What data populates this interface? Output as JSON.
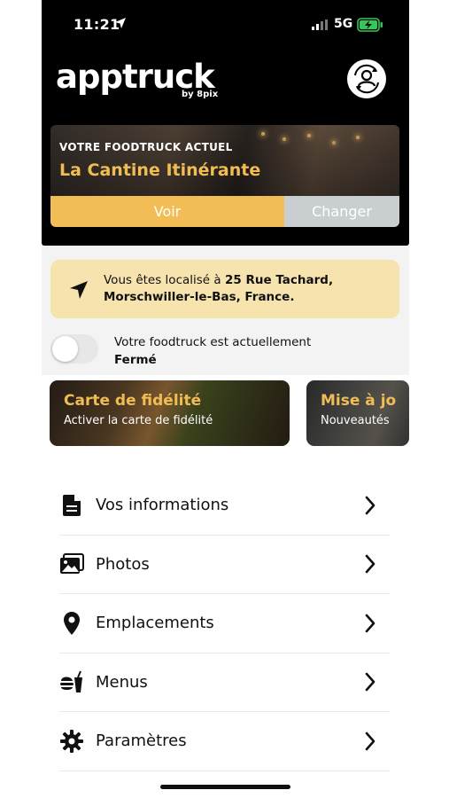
{
  "status_bar": {
    "time": "11:21",
    "network": "5G"
  },
  "header": {
    "logo": "apptruck",
    "byline": "by 8pix"
  },
  "current_truck": {
    "kicker": "VOTRE FOODTRUCK ACTUEL",
    "name": "La Cantine Itinérante",
    "view_label": "Voir",
    "change_label": "Changer"
  },
  "location": {
    "prefix": "Vous êtes localisé à ",
    "address_line1": "25 Rue Tachard,",
    "address_line2": "Morschwiller-le-Bas, France."
  },
  "status": {
    "text": "Votre foodtruck est actuellement",
    "value": "Fermé",
    "open": false
  },
  "cards": [
    {
      "title": "Carte de fidélité",
      "subtitle": "Activer la carte de fidélité"
    },
    {
      "title": "Mise à jo",
      "subtitle": "Nouveautés"
    }
  ],
  "menu": [
    {
      "label": "Vos informations",
      "icon": "document-icon"
    },
    {
      "label": "Photos",
      "icon": "photos-icon"
    },
    {
      "label": "Emplacements",
      "icon": "map-pin-icon"
    },
    {
      "label": "Menus",
      "icon": "food-icon"
    },
    {
      "label": "Paramètres",
      "icon": "gear-icon"
    }
  ],
  "colors": {
    "accent": "#f2bd55",
    "location_bg": "#f7e3ae",
    "secondary_button": "#c9cfd0"
  }
}
